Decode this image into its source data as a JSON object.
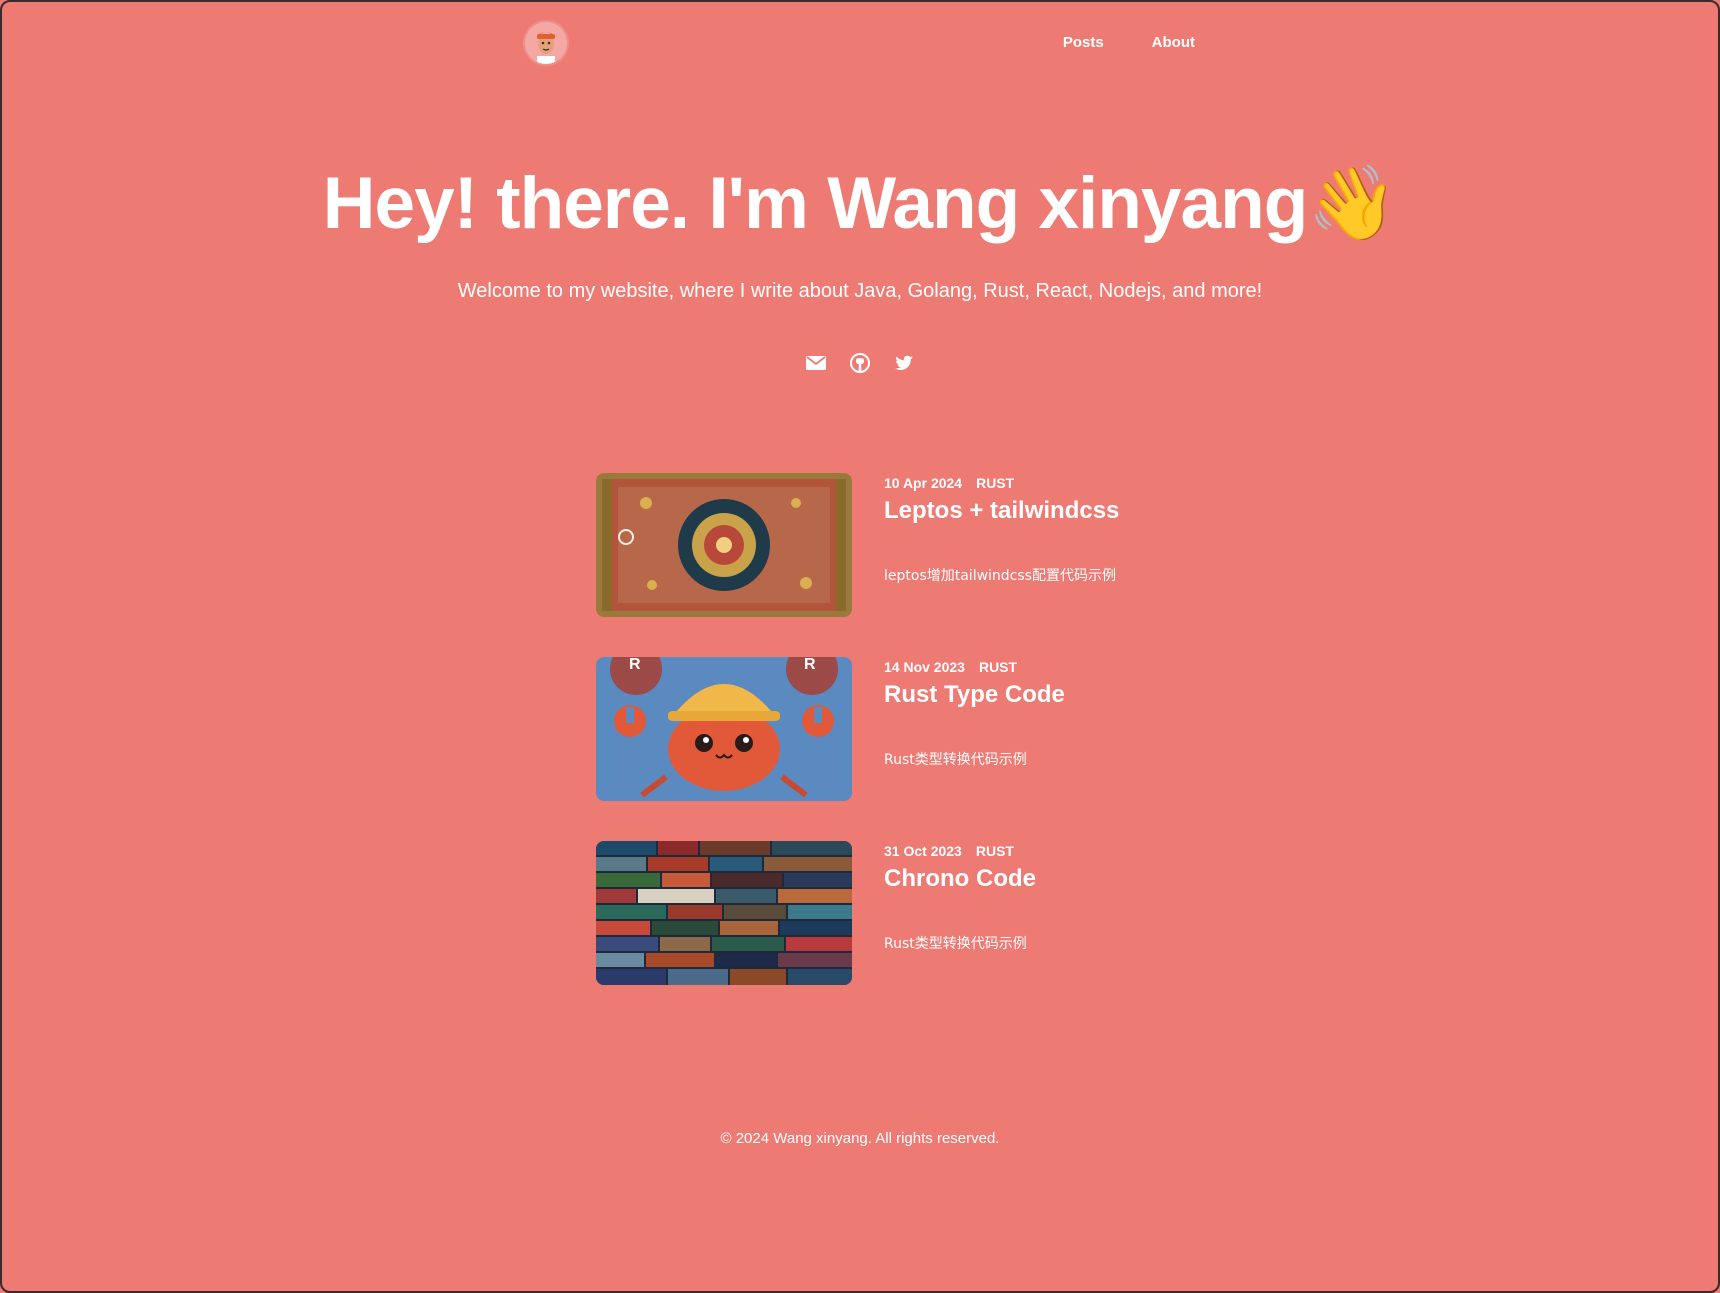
{
  "colors": {
    "background": "#ed7b74",
    "text": "#ffffff"
  },
  "header": {
    "avatar_icon": "avatar-icon",
    "nav": [
      {
        "label": "Posts"
      },
      {
        "label": "About"
      }
    ]
  },
  "hero": {
    "title": "Hey! there. I'm Wang xinyang👋",
    "subtitle": "Welcome to my website, where I write about Java, Golang, Rust, React, Nodejs, and more!",
    "socials": [
      "mail-icon",
      "github-icon",
      "twitter-icon"
    ]
  },
  "posts": [
    {
      "date": "10 Apr 2024",
      "tag": "RUST",
      "title": "Leptos + tailwindcss",
      "description": "leptos增加tailwindcss配置代码示例",
      "image": "carpet-image"
    },
    {
      "date": "14 Nov 2023",
      "tag": "RUST",
      "title": "Rust Type Code",
      "description": "Rust类型转换代码示例",
      "image": "crab-image"
    },
    {
      "date": "31 Oct 2023",
      "tag": "RUST",
      "title": "Chrono Code",
      "description": "Rust类型转换代码示例",
      "image": "books-image"
    }
  ],
  "footer": {
    "text": "© 2024 Wang xinyang. All rights reserved."
  }
}
